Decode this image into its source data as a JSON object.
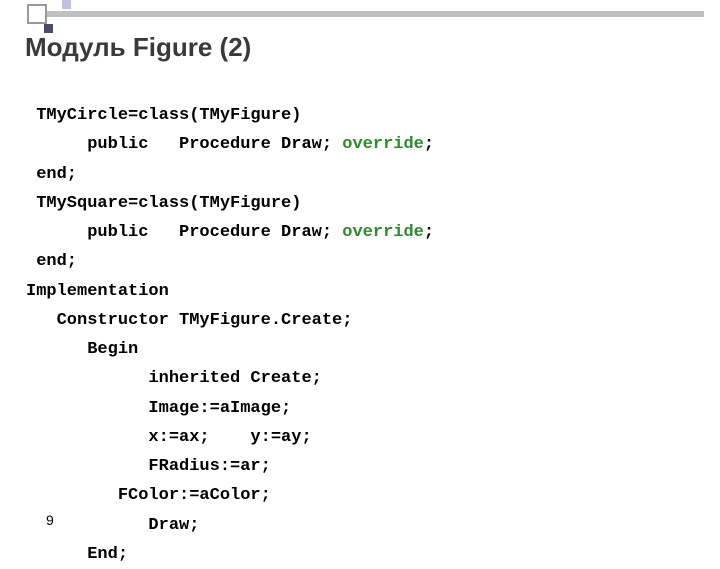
{
  "title": "Модуль Figure (2)",
  "slide_number": "9",
  "code": {
    "l1": " TMyCircle=class(TMyFigure)",
    "l2a": "      public   Procedure Draw; ",
    "l2b": "override",
    "l2c": ";",
    "l3": " end;",
    "l4": " TMySquare=class(TMyFigure)",
    "l5a": "      public   Procedure Draw; ",
    "l5b": "override",
    "l5c": ";",
    "l6": " end;",
    "l7": "Implementation",
    "l8": "   Constructor TMyFigure.Create;",
    "l9": "      Begin",
    "l10": "            inherited Create;",
    "l11": "            Image:=aImage;",
    "l12": "            x:=ax;    y:=ay;",
    "l13": "            FRadius:=ar;",
    "l14": "         FColor:=aColor;",
    "l15": "            Draw;",
    "l16": "      End;"
  }
}
